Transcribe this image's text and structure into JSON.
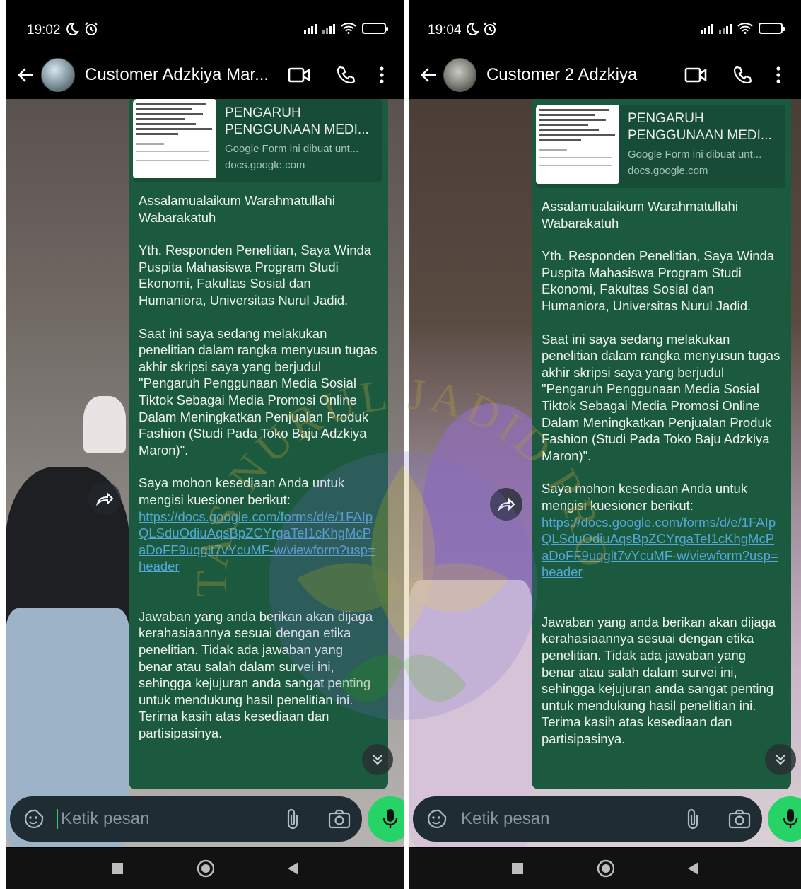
{
  "screens": [
    {
      "status": {
        "time": "19:02",
        "battery": "80",
        "battery_level": 0.8
      },
      "header": {
        "contact_name": "Customer Adzkiya Mar..."
      },
      "preview": {
        "title": "PENGARUH PENGGUNAAN MEDI...",
        "description": "Google Form ini dibuat unt...",
        "domain": "docs.google.com"
      },
      "message": {
        "greeting": "Assalamualaikum Warahmatullahi Wabarakatuh",
        "intro": "Yth. Responden Penelitian, Saya Winda Puspita Mahasiswa Program Studi Ekonomi, Fakultas Sosial dan Humaniora, Universitas Nurul Jadid.",
        "body": "Saat ini saya sedang melakukan penelitian dalam rangka menyusun tugas akhir skripsi saya yang berjudul \"Pengaruh Penggunaan Media Sosial Tiktok Sebagai Media Promosi Online Dalam Meningkatkan Penjualan Produk Fashion (Studi Pada Toko Baju Adzkiya Maron)\".",
        "request": "Saya mohon kesediaan Anda untuk mengisi kuesioner berikut:",
        "link": "https://docs.google.com/forms/d/e/1FAIpQLSduOdiuAqsBpZCYrgaTeI1cKhgMcPaDoFF9uqglt7vYcuMF-w/viewform?usp=header",
        "closing": "Jawaban yang anda berikan akan dijaga kerahasiaannya sesuai dengan etika penelitian. Tidak ada jawaban yang benar atau salah dalam survei ini, sehingga kejujuran anda sangat penting untuk mendukung hasil penelitian ini. Terima kasih atas kesediaan dan partisipasinya."
      },
      "input": {
        "placeholder": "Ketik pesan"
      }
    },
    {
      "status": {
        "time": "19:04",
        "battery": "79",
        "battery_level": 0.79
      },
      "header": {
        "contact_name": "Customer 2 Adzkiya"
      },
      "preview": {
        "title": "PENGARUH PENGGUNAAN MEDI...",
        "description": "Google Form ini dibuat unt...",
        "domain": "docs.google.com"
      },
      "message": {
        "greeting": "Assalamualaikum Warahmatullahi Wabarakatuh",
        "intro": "Yth. Responden Penelitian, Saya Winda Puspita Mahasiswa Program Studi Ekonomi, Fakultas Sosial dan Humaniora, Universitas Nurul Jadid.",
        "body": "Saat ini saya sedang melakukan penelitian dalam rangka menyusun tugas akhir skripsi saya yang berjudul \"Pengaruh Penggunaan Media Sosial Tiktok Sebagai Media Promosi Online Dalam Meningkatkan Penjualan Produk Fashion (Studi Pada Toko Baju Adzkiya Maron)\".",
        "request": "Saya mohon kesediaan Anda untuk mengisi kuesioner berikut:",
        "link": "https://docs.google.com/forms/d/e/1FAIpQLSduOdiuAqsBpZCYrgaTeI1cKhgMcPaDoFF9uqglt7vYcuMF-w/viewform?usp=header",
        "closing": "Jawaban yang anda berikan akan dijaga kerahasiaannya sesuai dengan etika penelitian. Tidak ada jawaban yang benar atau salah dalam survei ini, sehingga kejujuran anda sangat penting untuk mendukung hasil penelitian ini. Terima kasih atas kesediaan dan partisipasinya."
      },
      "input": {
        "placeholder": "Ketik pesan"
      }
    }
  ],
  "watermark": {
    "text": "UNIVERSITAS NURUL JADID PROBOLINGGO"
  },
  "colors": {
    "bubble": "#1b5a3f",
    "link": "#53a8d6",
    "accent": "#25d366",
    "input_bg": "#1f2c33"
  },
  "icons": [
    "moon-icon",
    "alarm-icon",
    "signal-icon",
    "wifi-icon",
    "battery-icon",
    "back-arrow-icon",
    "video-call-icon",
    "phone-call-icon",
    "more-vert-icon",
    "forward-icon",
    "scroll-down-icon",
    "sticker-icon",
    "attach-icon",
    "camera-icon",
    "mic-icon",
    "nav-recents-icon",
    "nav-home-icon",
    "nav-back-icon"
  ]
}
